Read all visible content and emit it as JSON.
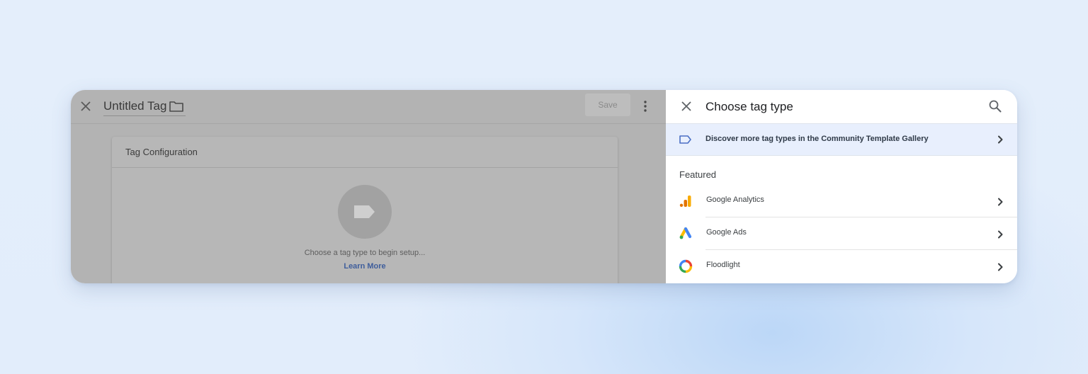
{
  "editor": {
    "title": "Untitled Tag",
    "save_label": "Save",
    "tag_configuration": {
      "title": "Tag Configuration",
      "hint": "Choose a tag type to begin setup...",
      "learn_more": "Learn More"
    }
  },
  "panel": {
    "title": "Choose tag type",
    "discover_text": "Discover more tag types in the Community Template Gallery",
    "featured_label": "Featured",
    "items": [
      {
        "label": "Google Analytics",
        "icon": "google-analytics-icon"
      },
      {
        "label": "Google Ads",
        "icon": "google-ads-icon"
      },
      {
        "label": "Floodlight",
        "icon": "floodlight-icon"
      }
    ]
  },
  "colors": {
    "overlay_gray": "#b3b3b3",
    "discover_highlight": "#e8effd",
    "link_blue": "#3f5e9c",
    "analytics_orange": "#f9ab00",
    "ads_blue": "#4285f4",
    "ads_yellow": "#fbbc04",
    "ads_green": "#34a853"
  }
}
